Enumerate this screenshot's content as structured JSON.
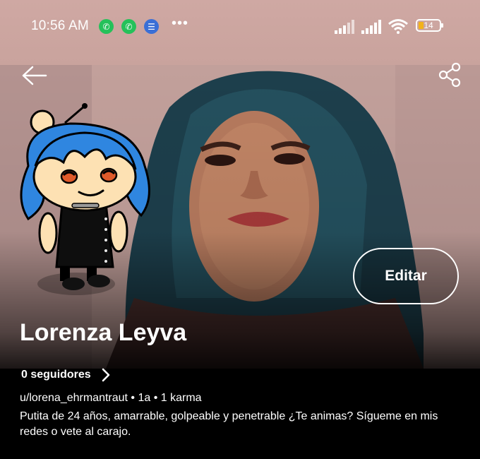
{
  "status_bar": {
    "time": "10:56 AM",
    "notification_icons": [
      "whatsapp-icon",
      "whatsapp-icon",
      "messages-icon"
    ],
    "more": "•••",
    "battery": "14",
    "battery_color": "#f2b21b"
  },
  "header": {
    "back_icon": "arrow-left-icon",
    "share_icon": "share-icon"
  },
  "profile": {
    "name": "Lorenza Leyva",
    "edit_label": "Editar",
    "followers": "0 seguidores",
    "meta": "u/lorena_ehrmantraut • 1a • 1 karma",
    "bio": "Putita de 24 años, amarrable, golpeable y penetrable ¿Te animas? Sígueme en mis redes o vete al carajo."
  },
  "colors": {
    "status_bar_bg": "#cfa8a3",
    "avatar_hair": "#2f86e0",
    "body_bg": "#000000"
  }
}
